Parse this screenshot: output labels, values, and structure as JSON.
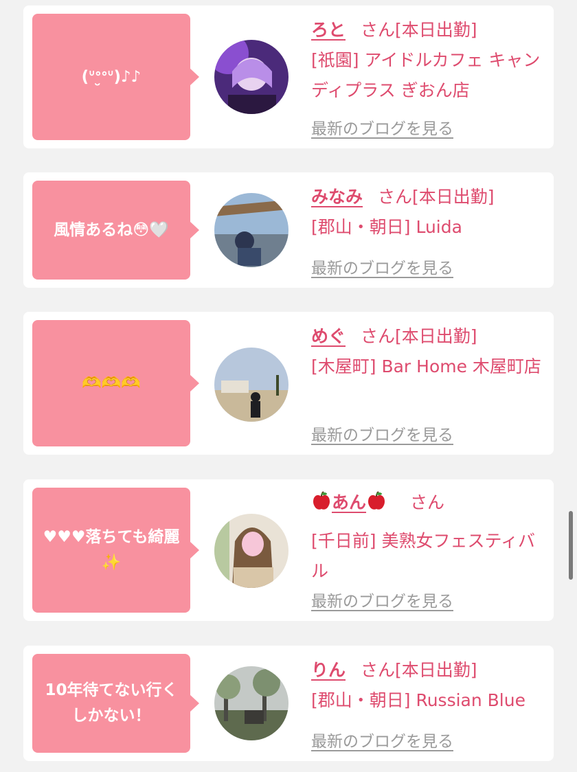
{
  "suffix": "さん",
  "blog_link_label": "最新のブログを見る",
  "cards": [
    {
      "bubble": "(ᐡᐤ̮ᐤᐡ)♪♪",
      "name": "ろと",
      "status": "[本日出勤]",
      "shop": "[祇園] アイドルカフェ キャンディプラス ぎおん店"
    },
    {
      "bubble": "風情あるね😳🤍",
      "name": "みなみ",
      "status": "[本日出勤]",
      "shop": "[郡山・朝日] Luida"
    },
    {
      "bubble": "🫶🫶🫶",
      "name": "めぐ",
      "status": "[本日出勤]",
      "shop": "[木屋町] Bar Home 木屋町店"
    },
    {
      "bubble": "♥♥♥落ちても綺麗✨",
      "name": "あん",
      "status": "",
      "shop": "[千日前] 美熟女フェスティバル"
    },
    {
      "bubble": "10年待てない行くしかない！",
      "name": "りん",
      "status": "[本日出勤]",
      "shop": "[郡山・朝日] Russian Blue"
    }
  ],
  "colors": {
    "accent": "#de4b6e",
    "bubble": "#f8919f",
    "link": "#9a9a9a",
    "background": "#f2f2f2"
  }
}
